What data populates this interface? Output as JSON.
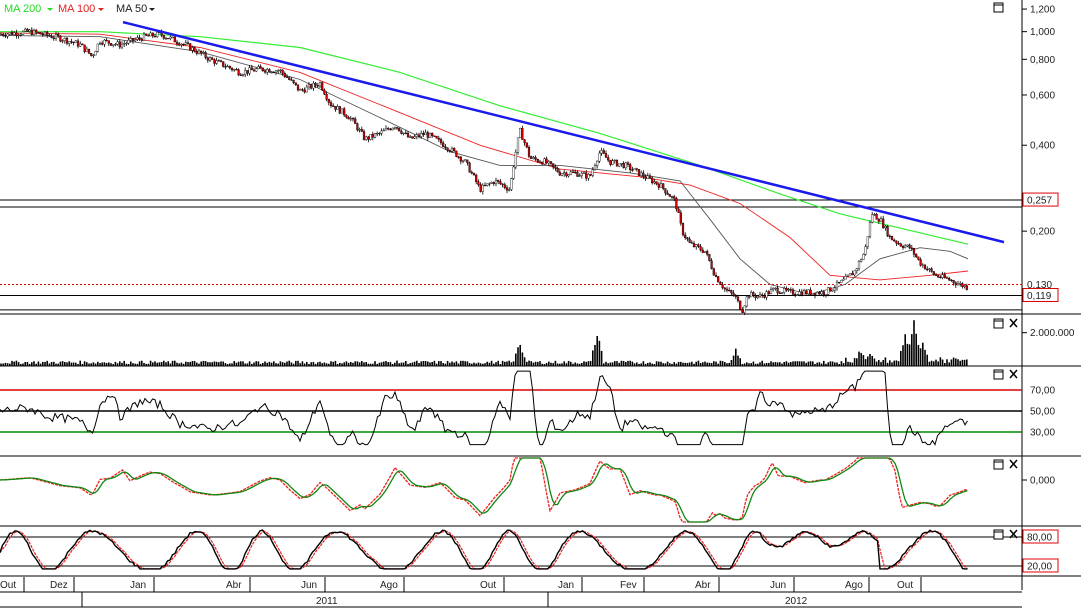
{
  "legend": [
    {
      "label": "MA 200",
      "color": "#22dd22"
    },
    {
      "label": "MA 100",
      "color": "#e02020"
    },
    {
      "label": "MA 50",
      "color": "#222222"
    }
  ],
  "colors": {
    "trendline": "#1a1aee",
    "ma200": "#33ee33",
    "ma100": "#ee2222",
    "ma50": "#555555",
    "candle_down": "#cc0000",
    "candle_up": "#ffffff",
    "hline_red": "#dd0000",
    "hline_green": "#008800"
  },
  "chart_data": [
    {
      "type": "line",
      "name": "price",
      "scale": "log",
      "ylim": [
        0.105,
        1.25
      ],
      "y_ticks": [
        "1,200",
        "1,000",
        "0,800",
        "0,600",
        "0,400",
        "0,200"
      ],
      "y_tick_values": [
        1.2,
        1.0,
        0.8,
        0.6,
        0.4,
        0.2
      ],
      "price_labels": [
        {
          "text": "0,257",
          "value": 0.257
        },
        {
          "text": "0,130",
          "value": 0.13
        },
        {
          "text": "0,119",
          "value": 0.119
        }
      ],
      "horizontal_lines": [
        0.257,
        0.243,
        0.119,
        0.106
      ],
      "dotted_line": 0.13,
      "price_path": [
        [
          0,
          0.98
        ],
        [
          30,
          1.0
        ],
        [
          60,
          0.95
        ],
        [
          80,
          0.9
        ],
        [
          92,
          0.82
        ],
        [
          100,
          0.93
        ],
        [
          120,
          0.9
        ],
        [
          145,
          0.96
        ],
        [
          160,
          0.98
        ],
        [
          185,
          0.9
        ],
        [
          210,
          0.8
        ],
        [
          240,
          0.72
        ],
        [
          260,
          0.74
        ],
        [
          280,
          0.73
        ],
        [
          300,
          0.62
        ],
        [
          320,
          0.66
        ],
        [
          330,
          0.56
        ],
        [
          350,
          0.5
        ],
        [
          365,
          0.42
        ],
        [
          380,
          0.44
        ],
        [
          395,
          0.47
        ],
        [
          410,
          0.42
        ],
        [
          425,
          0.44
        ],
        [
          445,
          0.4
        ],
        [
          465,
          0.35
        ],
        [
          480,
          0.28
        ],
        [
          495,
          0.3
        ],
        [
          510,
          0.28
        ],
        [
          520,
          0.45
        ],
        [
          530,
          0.36
        ],
        [
          545,
          0.35
        ],
        [
          560,
          0.32
        ],
        [
          575,
          0.32
        ],
        [
          590,
          0.31
        ],
        [
          600,
          0.38
        ],
        [
          610,
          0.35
        ],
        [
          625,
          0.34
        ],
        [
          645,
          0.31
        ],
        [
          660,
          0.29
        ],
        [
          675,
          0.255
        ],
        [
          682,
          0.2
        ],
        [
          690,
          0.18
        ],
        [
          705,
          0.17
        ],
        [
          715,
          0.14
        ],
        [
          725,
          0.125
        ],
        [
          735,
          0.118
        ],
        [
          742,
          0.105
        ],
        [
          748,
          0.12
        ],
        [
          760,
          0.118
        ],
        [
          775,
          0.125
        ],
        [
          790,
          0.122
        ],
        [
          810,
          0.122
        ],
        [
          825,
          0.122
        ],
        [
          835,
          0.128
        ],
        [
          845,
          0.135
        ],
        [
          855,
          0.145
        ],
        [
          865,
          0.17
        ],
        [
          872,
          0.23
        ],
        [
          880,
          0.22
        ],
        [
          890,
          0.19
        ],
        [
          900,
          0.18
        ],
        [
          910,
          0.175
        ],
        [
          920,
          0.155
        ],
        [
          935,
          0.14
        ],
        [
          950,
          0.135
        ],
        [
          960,
          0.13
        ],
        [
          968,
          0.127
        ]
      ],
      "ma200_path": [
        [
          0,
          1.0
        ],
        [
          100,
          1.0
        ],
        [
          200,
          0.96
        ],
        [
          300,
          0.88
        ],
        [
          400,
          0.72
        ],
        [
          500,
          0.55
        ],
        [
          600,
          0.44
        ],
        [
          700,
          0.34
        ],
        [
          780,
          0.27
        ],
        [
          840,
          0.23
        ],
        [
          900,
          0.205
        ],
        [
          968,
          0.18
        ]
      ],
      "ma100_path": [
        [
          0,
          0.99
        ],
        [
          100,
          0.98
        ],
        [
          200,
          0.88
        ],
        [
          300,
          0.72
        ],
        [
          400,
          0.52
        ],
        [
          480,
          0.4
        ],
        [
          560,
          0.33
        ],
        [
          640,
          0.31
        ],
        [
          690,
          0.29
        ],
        [
          740,
          0.25
        ],
        [
          790,
          0.19
        ],
        [
          830,
          0.14
        ],
        [
          880,
          0.135
        ],
        [
          930,
          0.14
        ],
        [
          968,
          0.145
        ]
      ],
      "ma50_path": [
        [
          0,
          0.97
        ],
        [
          100,
          0.96
        ],
        [
          200,
          0.85
        ],
        [
          300,
          0.68
        ],
        [
          380,
          0.5
        ],
        [
          450,
          0.38
        ],
        [
          500,
          0.34
        ],
        [
          560,
          0.34
        ],
        [
          630,
          0.32
        ],
        [
          680,
          0.3
        ],
        [
          710,
          0.22
        ],
        [
          740,
          0.16
        ],
        [
          770,
          0.13
        ],
        [
          810,
          0.12
        ],
        [
          845,
          0.13
        ],
        [
          880,
          0.16
        ],
        [
          920,
          0.175
        ],
        [
          950,
          0.17
        ],
        [
          968,
          0.16
        ]
      ],
      "trendline": [
        [
          123,
          1.08
        ],
        [
          1004,
          0.183
        ]
      ]
    },
    {
      "type": "bar",
      "name": "volume",
      "ylim": [
        0,
        3000000
      ],
      "y_ticks": [
        "2.000.000"
      ],
      "y_tick_values": [
        2000000
      ]
    },
    {
      "type": "line",
      "name": "oscillator-1",
      "ylim": [
        0,
        100
      ],
      "levels": [
        {
          "text": "70,00",
          "value": 70,
          "color": "#dd0000"
        },
        {
          "text": "50,00",
          "value": 50,
          "color": "#000000"
        },
        {
          "text": "30,00",
          "value": 30,
          "color": "#008800"
        }
      ]
    },
    {
      "type": "line",
      "name": "oscillator-2",
      "y_ticks": [
        "0,000"
      ],
      "y_tick_values": [
        0
      ]
    },
    {
      "type": "line",
      "name": "oscillator-3",
      "ylim": [
        0,
        100
      ],
      "levels": [
        {
          "text": "80,00",
          "value": 80
        },
        {
          "text": "20,00",
          "value": 20
        }
      ]
    }
  ],
  "x_axis": {
    "months": [
      {
        "label": "Out",
        "x": 0
      },
      {
        "label": "Dez",
        "x": 50
      },
      {
        "label": "Jan",
        "x": 130
      },
      {
        "label": "Abr",
        "x": 226
      },
      {
        "label": "Jun",
        "x": 301
      },
      {
        "label": "Ago",
        "x": 380
      },
      {
        "label": "Out",
        "x": 480
      },
      {
        "label": "Jan",
        "x": 558
      },
      {
        "label": "Fev",
        "x": 620
      },
      {
        "label": "Abr",
        "x": 695
      },
      {
        "label": "Jun",
        "x": 770
      },
      {
        "label": "Ago",
        "x": 845
      },
      {
        "label": "Out",
        "x": 897
      }
    ],
    "years": [
      {
        "label": "2011",
        "x": 316
      },
      {
        "label": "2012",
        "x": 785
      }
    ]
  }
}
